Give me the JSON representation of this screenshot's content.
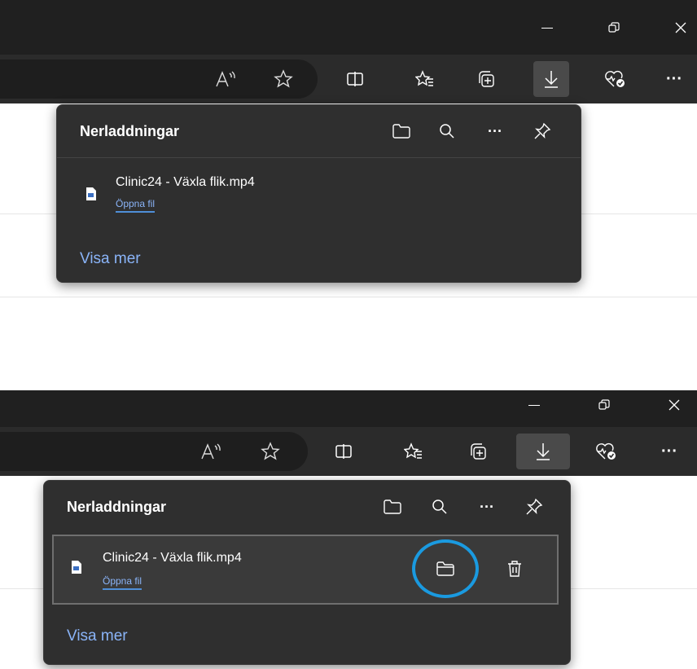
{
  "toolbar": {
    "read_aloud_icon": "read-aloud-icon",
    "favorite_icon": "star-icon",
    "split_screen_icon": "split-screen-icon",
    "favorites_icon": "favorites-list-icon",
    "collections_icon": "collections-icon",
    "downloads_icon": "download-icon",
    "performance_icon": "heart-check-icon",
    "more_label": "···"
  },
  "window": {
    "minimize_label": "—",
    "close_label": "✕"
  },
  "downloads_panel": {
    "title": "Nerladdningar",
    "more_label": "···",
    "item": {
      "file_name": "Clinic24 - Växla flik.mp4",
      "open_label": "Öppna fil"
    },
    "show_more_label": "Visa mer"
  },
  "colors": {
    "titlebar": "#202020",
    "toolbar": "#2b2b2b",
    "panel": "#2f2f2f",
    "link": "#8ab4f8",
    "highlight": "#1a9ae0"
  }
}
